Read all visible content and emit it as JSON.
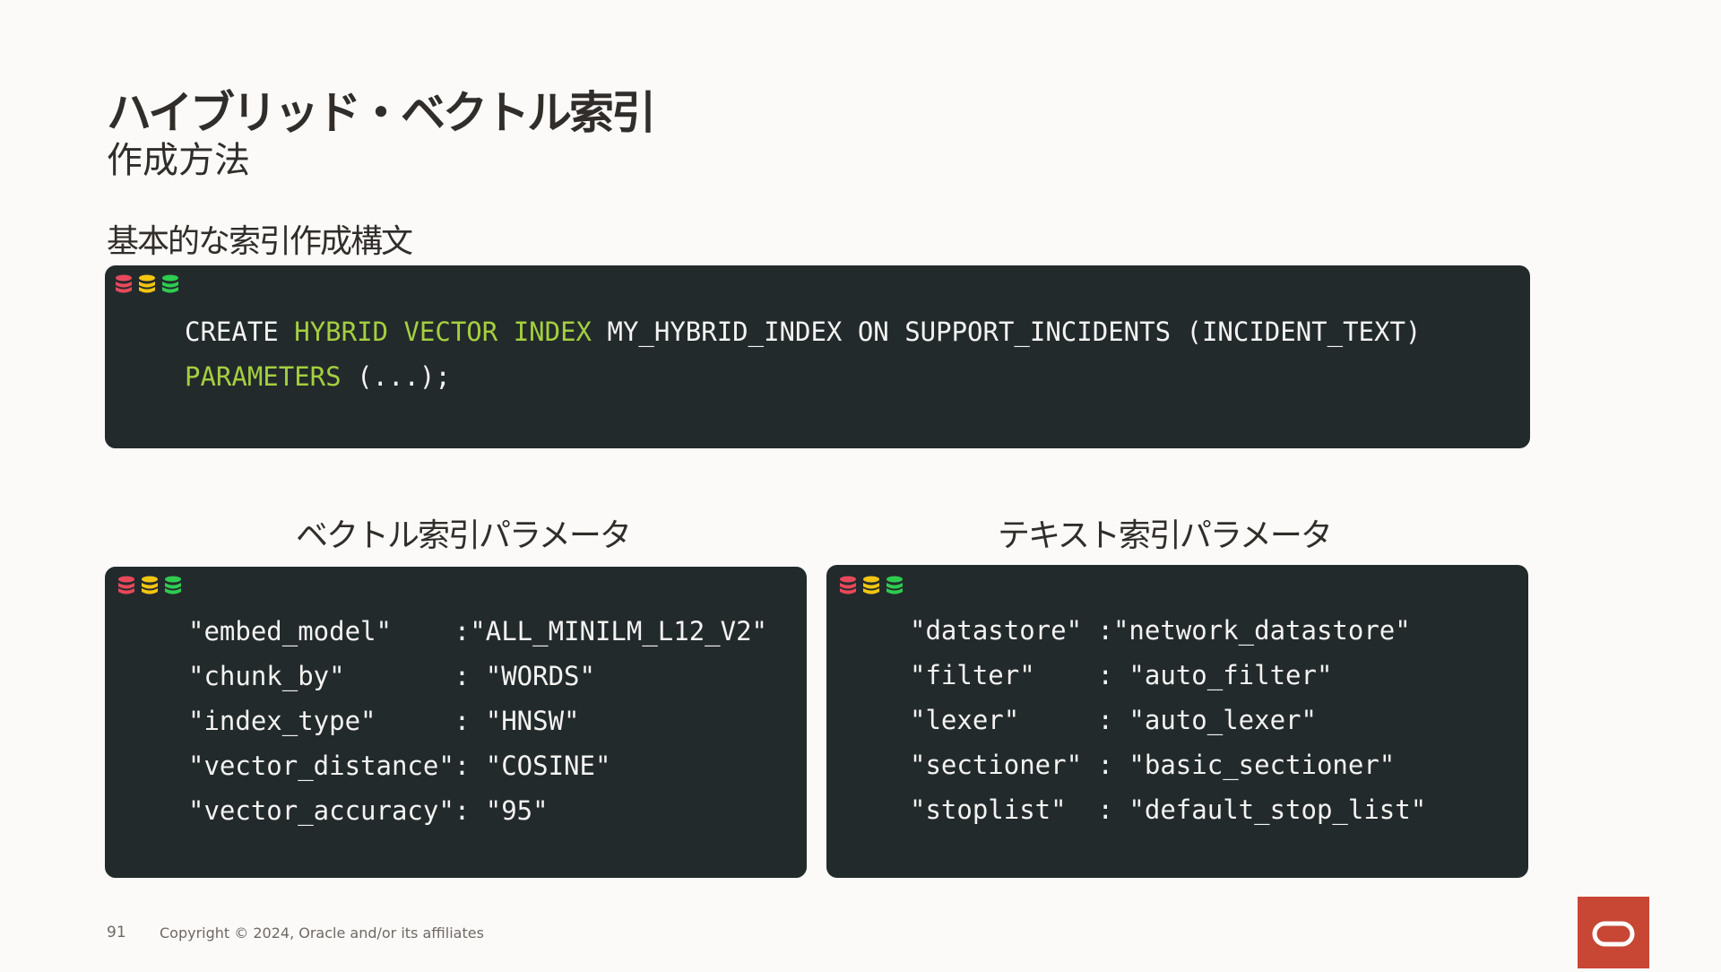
{
  "slide": {
    "title": "ハイブリッド・ベクトル索引",
    "subtitle": "作成方法",
    "syntax_heading": "基本的な索引作成構文",
    "vector_heading": "ベクトル索引パラメータ",
    "text_heading": "テキスト索引パラメータ"
  },
  "colors": {
    "background": "#fbfaf8",
    "panel": "#232a2c",
    "keyword": "#a4cf3f",
    "code_text": "#f3f3f1",
    "oracle_red": "#c74634",
    "dot_red": "#e8485b",
    "dot_yellow": "#f2c511",
    "dot_green": "#2ecc4f"
  },
  "syntax_code": {
    "line1": {
      "create": "CREATE",
      "hybrid": "HYBRID",
      "vector": "VECTOR",
      "index": "INDEX",
      "rest": "MY_HYBRID_INDEX ON SUPPORT_INCIDENTS (INCIDENT_TEXT)"
    },
    "line2": {
      "parameters": "PARAMETERS",
      "rest": "(...);"
    }
  },
  "vector_params": [
    "\"embed_model\"    :\"ALL_MINILM_L12_V2\"",
    "\"chunk_by\"       : \"WORDS\"",
    "\"index_type\"     : \"HNSW\"",
    "\"vector_distance\": \"COSINE\"",
    "\"vector_accuracy\": \"95\""
  ],
  "text_params": [
    "\"datastore\" :\"network_datastore\"",
    "\"filter\"    : \"auto_filter\"",
    "\"lexer\"     : \"auto_lexer\"",
    "\"sectioner\" : \"basic_sectioner\"",
    "\"stoplist\"  : \"default_stop_list\""
  ],
  "footer": {
    "page_number": "91",
    "copyright": "Copyright © 2024, Oracle and/or its affiliates"
  },
  "icons": {
    "dots": "database-stack-icon",
    "logo": "oracle-logo-icon"
  }
}
